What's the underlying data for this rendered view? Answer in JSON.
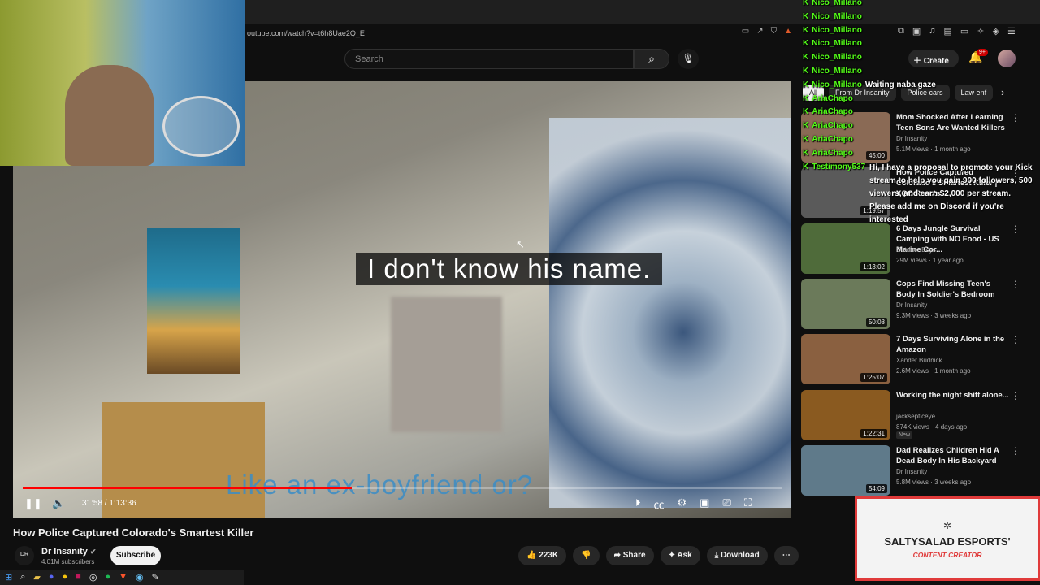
{
  "browser": {
    "url": "outube.com/watch?v=t6h8Uae2Q_E"
  },
  "header": {
    "search_placeholder": "Search",
    "create_label": "Create",
    "notifications_badge": "9+"
  },
  "chips": [
    "All",
    "From Dr Insanity",
    "Police cars",
    "Law enf"
  ],
  "player": {
    "caption_main": "I don't know his name.",
    "caption_secondary": "Like an ex-boyfriend or?",
    "time": "31:58 / 1:13:36",
    "progress_fraction": 0.434
  },
  "video": {
    "title": "How Police Captured Colorado's Smartest Killer",
    "channel": "Dr Insanity",
    "channel_avatar_text": "DR",
    "subscribers": "4.01M subscribers",
    "subscribe_label": "Subscribe",
    "likes": "223K",
    "share_label": "Share",
    "ask_label": "Ask",
    "download_label": "Download"
  },
  "recommendations": [
    {
      "title": "Mom Shocked After Learning Teen Sons Are Wanted Killers",
      "channel": "Dr Insanity",
      "meta": "5.1M views · 1 month ago",
      "duration": "45:00",
      "color": "#8a6a55"
    },
    {
      "title": "How Police Captured Colorado's Smartest Killer | XQC Reacts",
      "channel": "",
      "meta": "",
      "duration": "1:19:57",
      "color": "#5a5a5a"
    },
    {
      "title": "6 Days Jungle Survival Camping with NO Food - US Marine Cor...",
      "channel": "Outdoor Boys",
      "meta": "29M views · 1 year ago",
      "duration": "1:13:02",
      "color": "#4f6b3a"
    },
    {
      "title": "Cops Find Missing Teen's Body In Soldier's Bedroom",
      "channel": "Dr Insanity",
      "meta": "9.3M views · 3 weeks ago",
      "duration": "50:08",
      "color": "#6b7a5a"
    },
    {
      "title": "7 Days Surviving Alone in the Amazon",
      "channel": "Xander Budnick",
      "meta": "2.6M views · 1 month ago",
      "duration": "1:25:07",
      "color": "#8a6040"
    },
    {
      "title": "Working the night shift alone...",
      "channel": "jacksepticeye",
      "meta": "874K views · 4 days ago",
      "duration": "1:22:31",
      "badge": "New",
      "color": "#8a5a20"
    },
    {
      "title": "Dad Realizes Children Hid A Dead Body In His Backyard",
      "channel": "Dr Insanity",
      "meta": "5.8M views · 3 weeks ago",
      "duration": "54:09",
      "color": "#5f7a8a"
    }
  ],
  "chat": [
    {
      "user": "Nico_Millano",
      "msg": ""
    },
    {
      "user": "Nico_Millano",
      "msg": ""
    },
    {
      "user": "Nico_Millano",
      "msg": ""
    },
    {
      "user": "Nico_Millano",
      "msg": ""
    },
    {
      "user": "Nico_Millano",
      "msg": ""
    },
    {
      "user": "Nico_Millano",
      "msg": ""
    },
    {
      "user": "Nico_Millano",
      "msg": "Waiting naba gaze"
    },
    {
      "user": "AriaChapo",
      "msg": ""
    },
    {
      "user": "AriaChapo",
      "msg": ""
    },
    {
      "user": "AriaChapo",
      "msg": ""
    },
    {
      "user": "AriaChapo",
      "msg": ""
    },
    {
      "user": "AriaChapo",
      "msg": ""
    },
    {
      "user": "Testimony537",
      "msg": ""
    }
  ],
  "promo_message": "Hi, I have a proposal to promote your Kick stream to help you gain 900 followers, 500 viewers, and earn $2,000 per stream. Please add me on Discord if you're interested",
  "brand": {
    "name": "SALTYSALAD ESPORTS'",
    "subtitle": "CONTENT CREATOR"
  },
  "colors": {
    "accent": "#ff0000",
    "kick_green": "#53fc18",
    "brand_red": "#e03a3a"
  }
}
